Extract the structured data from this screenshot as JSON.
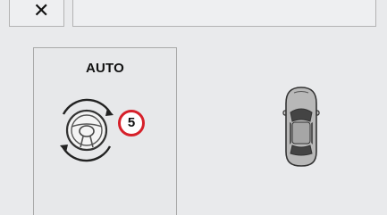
{
  "toolbar": {
    "close_glyph": "✕"
  },
  "auto_tile": {
    "label": "AUTO",
    "badge_number": "5",
    "icon": "steering-wheel-auto-rotate-icon"
  },
  "vehicle": {
    "icon": "car-top-view-icon"
  },
  "colors": {
    "background": "#e9eaec",
    "badge_ring": "#d6202a",
    "border": "#a9a9a9",
    "icon_stroke": "#222222"
  }
}
